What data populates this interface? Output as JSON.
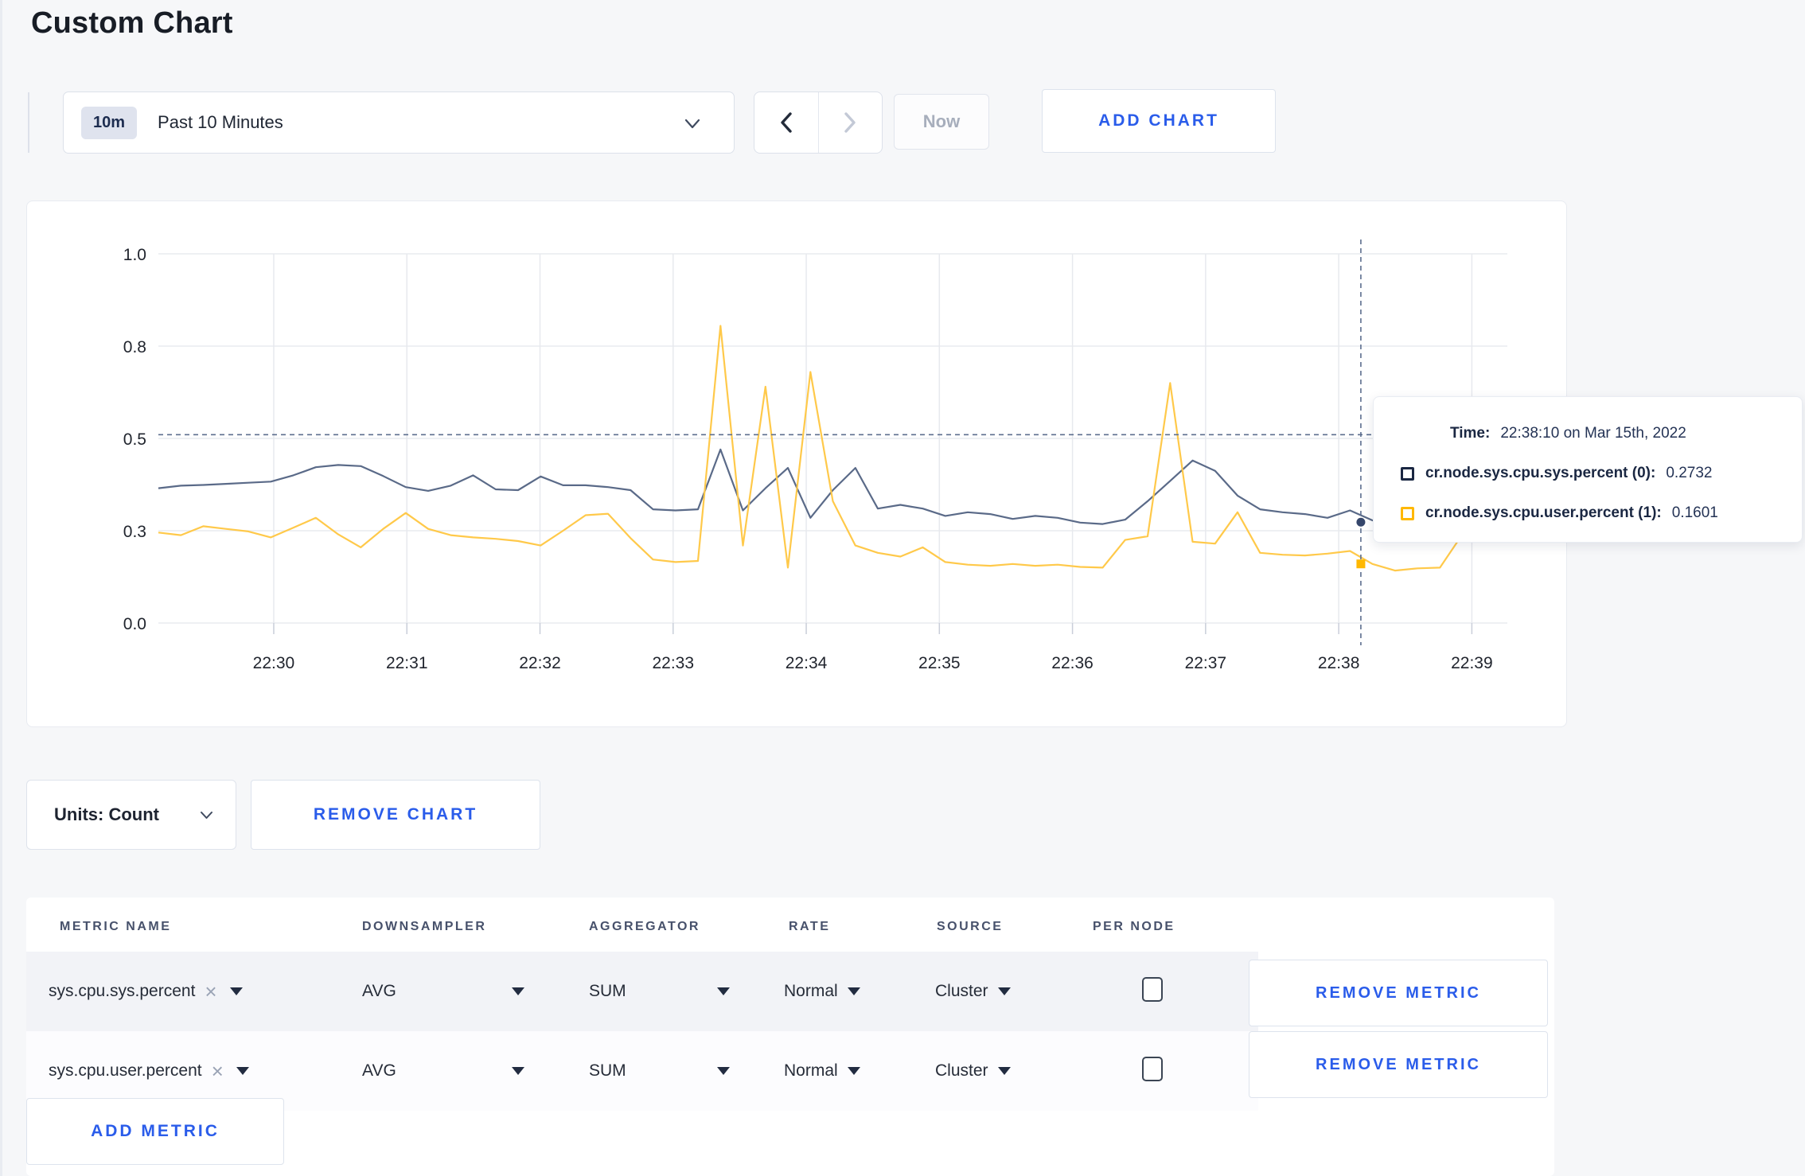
{
  "page": {
    "title": "Custom Chart"
  },
  "toolbar": {
    "range_badge": "10m",
    "range_label": "Past 10 Minutes",
    "prev_arrow": "chevron-left",
    "next_arrow": "chevron-right",
    "now_label": "Now",
    "add_chart_label": "ADD CHART"
  },
  "tooltip": {
    "time_label": "Time:",
    "time_value": "22:38:10 on Mar 15th, 2022",
    "series": [
      {
        "label": "cr.node.sys.cpu.sys.percent (0):",
        "value": "0.2732",
        "color": "#1a2742"
      },
      {
        "label": "cr.node.sys.cpu.user.percent (1):",
        "value": "0.1601",
        "color": "#ffb800"
      }
    ]
  },
  "controls": {
    "units_label": "Units: Count",
    "remove_chart_label": "REMOVE CHART",
    "add_metric_label": "ADD METRIC"
  },
  "table": {
    "headers": [
      "METRIC NAME",
      "DOWNSAMPLER",
      "AGGREGATOR",
      "RATE",
      "SOURCE",
      "PER NODE"
    ],
    "rows": [
      {
        "metric": "sys.cpu.sys.percent",
        "downsampler": "AVG",
        "aggregator": "SUM",
        "rate": "Normal",
        "source": "Cluster",
        "per_node_checked": false,
        "remove_label": "REMOVE METRIC"
      },
      {
        "metric": "sys.cpu.user.percent",
        "downsampler": "AVG",
        "aggregator": "SUM",
        "rate": "Normal",
        "source": "Cluster",
        "per_node_checked": false,
        "remove_label": "REMOVE METRIC"
      }
    ]
  },
  "ui_colors": {
    "accent_blue": "#2a5cea",
    "page_background": "#f6f7f9",
    "card_background": "#ffffff",
    "row_stripe": "#f2f3f7"
  },
  "chart_data": {
    "type": "line",
    "title": "",
    "xlabel": "",
    "ylabel": "",
    "ylim": [
      0,
      1
    ],
    "grid": true,
    "legend_position": "tooltip-overlay",
    "x_window": {
      "start": "22:29:08",
      "end": "22:39:16",
      "total_seconds": 608,
      "point_interval_seconds": 10
    },
    "x_ticks": {
      "labels": [
        "22:30",
        "22:31",
        "22:32",
        "22:33",
        "22:34",
        "22:35",
        "22:36",
        "22:37",
        "22:38",
        "22:39"
      ],
      "first_offset_seconds": 52,
      "interval_seconds": 60
    },
    "y_ticks": {
      "labels": [
        "1.0",
        "0.8",
        "0.5",
        "0.3",
        "0.0"
      ],
      "values": [
        1.0,
        0.75,
        0.5,
        0.25,
        0.0
      ]
    },
    "series": [
      {
        "name": "cr.node.sys.cpu.sys.percent",
        "color": "#5a6a88",
        "marker_color": "#35466b",
        "marker_shape": "circle",
        "values": [
          0.365,
          0.372,
          0.374,
          0.377,
          0.38,
          0.383,
          0.4,
          0.422,
          0.428,
          0.425,
          0.398,
          0.368,
          0.358,
          0.372,
          0.4,
          0.362,
          0.36,
          0.397,
          0.373,
          0.373,
          0.368,
          0.36,
          0.308,
          0.305,
          0.308,
          0.47,
          0.305,
          0.365,
          0.42,
          0.285,
          0.36,
          0.42,
          0.31,
          0.32,
          0.31,
          0.29,
          0.3,
          0.295,
          0.282,
          0.29,
          0.285,
          0.272,
          0.268,
          0.28,
          0.33,
          0.385,
          0.44,
          0.412,
          0.345,
          0.308,
          0.3,
          0.295,
          0.285,
          0.305,
          0.278,
          0.272,
          0.3,
          0.31,
          0.302,
          0.3,
          0.308
        ]
      },
      {
        "name": "cr.node.sys.cpu.user.percent",
        "color": "#ffc94a",
        "marker_color": "#ffb800",
        "marker_shape": "square",
        "values": [
          0.245,
          0.238,
          0.262,
          0.255,
          0.248,
          0.232,
          0.258,
          0.285,
          0.24,
          0.205,
          0.255,
          0.298,
          0.255,
          0.238,
          0.232,
          0.228,
          0.222,
          0.21,
          0.25,
          0.292,
          0.296,
          0.23,
          0.172,
          0.165,
          0.168,
          0.805,
          0.21,
          0.64,
          0.15,
          0.68,
          0.33,
          0.21,
          0.19,
          0.18,
          0.205,
          0.165,
          0.158,
          0.155,
          0.16,
          0.155,
          0.158,
          0.152,
          0.15,
          0.225,
          0.235,
          0.65,
          0.22,
          0.215,
          0.3,
          0.19,
          0.185,
          0.183,
          0.188,
          0.195,
          0.16,
          0.142,
          0.148,
          0.15,
          0.24,
          0.27,
          0.245
        ]
      }
    ],
    "crosshair": {
      "time": "22:38:10",
      "time_fraction": 0.8914,
      "hover_value": 0.51,
      "color": "#5c6e8e"
    },
    "hover_points": [
      {
        "series": 0,
        "value": 0.2732
      },
      {
        "series": 1,
        "value": 0.1601
      }
    ]
  }
}
